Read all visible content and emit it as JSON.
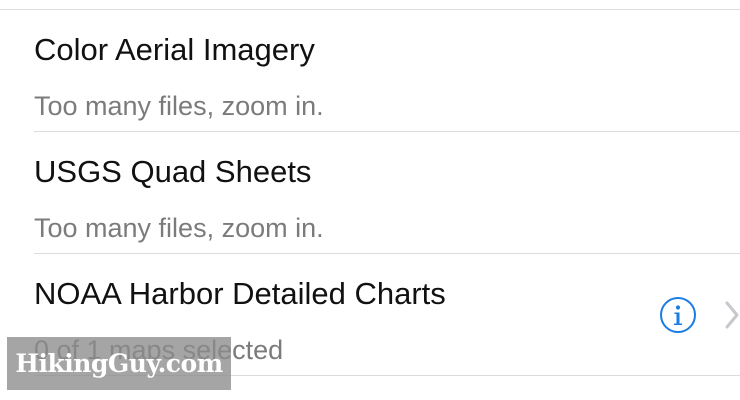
{
  "layers": [
    {
      "title": "Color Aerial Imagery",
      "status": "Too many files, zoom in."
    },
    {
      "title": "USGS Quad Sheets",
      "status": "Too many files, zoom in."
    },
    {
      "title": "NOAA Harbor Detailed Charts",
      "status": "0 of 1 maps selected",
      "info_icon": "info-circle-icon",
      "chevron_icon": "chevron-right-icon"
    }
  ],
  "watermark": "HikingGuy.com",
  "colors": {
    "title": "#111111",
    "subtitle": "#7b7b7b",
    "divider": "#dcdcdc",
    "accent": "#1a7ce5",
    "chevron": "#c7c7cc"
  }
}
